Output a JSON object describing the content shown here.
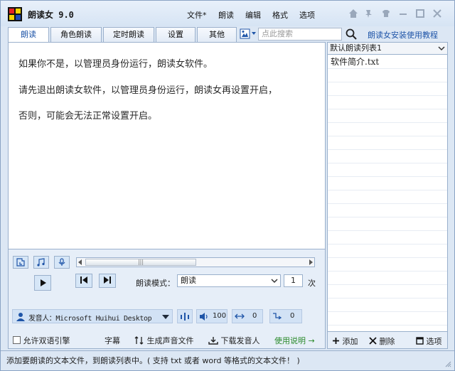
{
  "app": {
    "title": "朗读女 9.0"
  },
  "menu": {
    "file": "文件*",
    "read": "朗读",
    "edit": "编辑",
    "format": "格式",
    "options": "选项"
  },
  "tabs": [
    "朗读",
    "角色朗读",
    "定时朗读",
    "设置",
    "其他"
  ],
  "search": {
    "placeholder": "点此搜索"
  },
  "tutorial_link": "朗读女安装使用教程",
  "editor": {
    "lines": [
      "如果你不是，以管理员身份运行，朗读女软件。",
      "请先退出朗读女软件，以管理员身份运行，朗读女再设置开启，",
      "否则，可能会无法正常设置开启。"
    ]
  },
  "controls": {
    "mode_label": "朗读模式：",
    "mode_value": "朗读",
    "count_value": "1",
    "count_unit": "次",
    "voice_label": "发音人：Microsoft Huihui Desktop",
    "volume": "100",
    "speed": "0",
    "pitch": "0"
  },
  "bottom": {
    "stereo": "允许双语引擎",
    "subtitle": "字幕",
    "generate": "生成声音文件",
    "download": "下载发音人",
    "help": "使用说明 →"
  },
  "playlist": {
    "name": "默认朗读列表1",
    "items": [
      "软件简介.txt"
    ],
    "add": "添加",
    "delete": "删除",
    "options": "选项"
  },
  "status": "添加要朗读的文本文件，到朗读列表中。( 支持 txt 或者 word 等格式的文本文件！ )",
  "colors": {
    "accent": "#1f55a8",
    "link_green": "#2a8a2a",
    "icon_blue": "#1f55a8"
  }
}
